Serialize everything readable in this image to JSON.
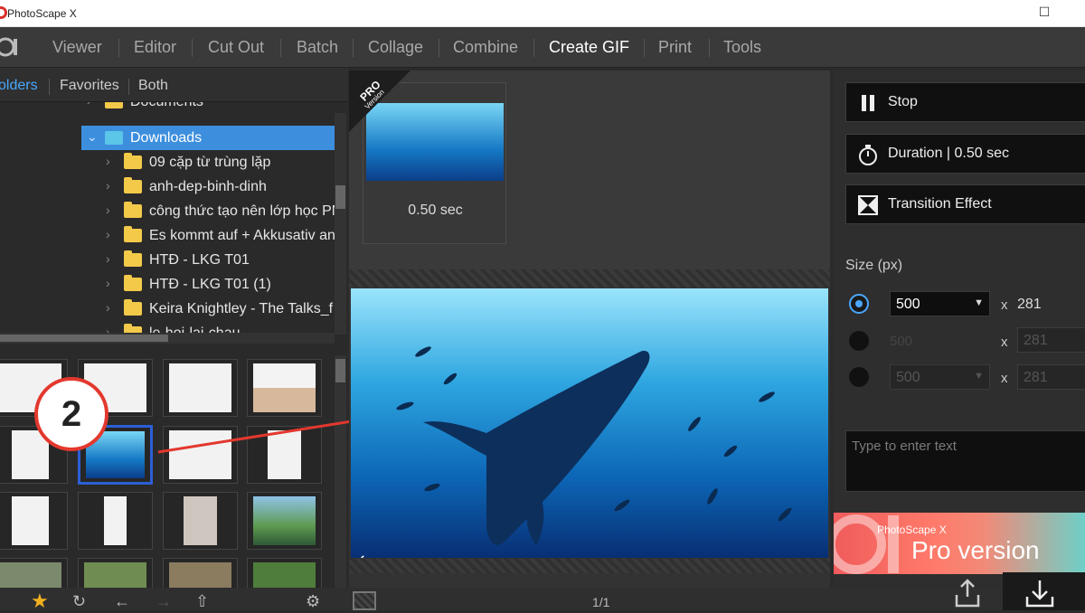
{
  "window": {
    "title": "PhotoScape X",
    "min": "—",
    "max": "☐"
  },
  "menu": {
    "items": [
      "Viewer",
      "Editor",
      "Cut Out",
      "Batch",
      "Collage",
      "Combine",
      "Create GIF",
      "Print",
      "Tools"
    ],
    "active": "Create GIF"
  },
  "tabs": {
    "folders": "olders",
    "favorites": "Favorites",
    "both": "Both"
  },
  "tree": {
    "items": [
      {
        "label": "Documents"
      },
      {
        "label": "Downloads"
      },
      {
        "label": "09 cặp từ trùng lặp"
      },
      {
        "label": "anh-dep-binh-dinh"
      },
      {
        "label": "công thức tạo nên lớp học PN"
      },
      {
        "label": "Es kommt auf + Akkusativ an"
      },
      {
        "label": "HTĐ - LKG T01"
      },
      {
        "label": "HTĐ - LKG T01 (1)"
      },
      {
        "label": "Keira Knightley - The Talks_f"
      },
      {
        "label": "le-hoi-lai-chau"
      }
    ],
    "selected": "Downloads"
  },
  "frame": {
    "duration_label": "0.50 sec",
    "pro_badge": "PRO",
    "pro_sub": "Version"
  },
  "controls": {
    "stop": "Stop",
    "duration": "Duration | 0.50 sec",
    "transition": "Transition Effect",
    "size_label": "Size (px)",
    "size_rows": [
      {
        "width": "500",
        "x": "x",
        "height": "281"
      },
      {
        "width": "500",
        "x": "x",
        "height": "281"
      },
      {
        "width": "500",
        "x": "x",
        "height": "281"
      }
    ],
    "text_placeholder": "Type to enter text"
  },
  "banner": {
    "brand": "PhotoScape X",
    "pro": "Pro",
    "version": " version"
  },
  "annotation": {
    "number": "2"
  },
  "footer": {
    "page": "1/1"
  }
}
